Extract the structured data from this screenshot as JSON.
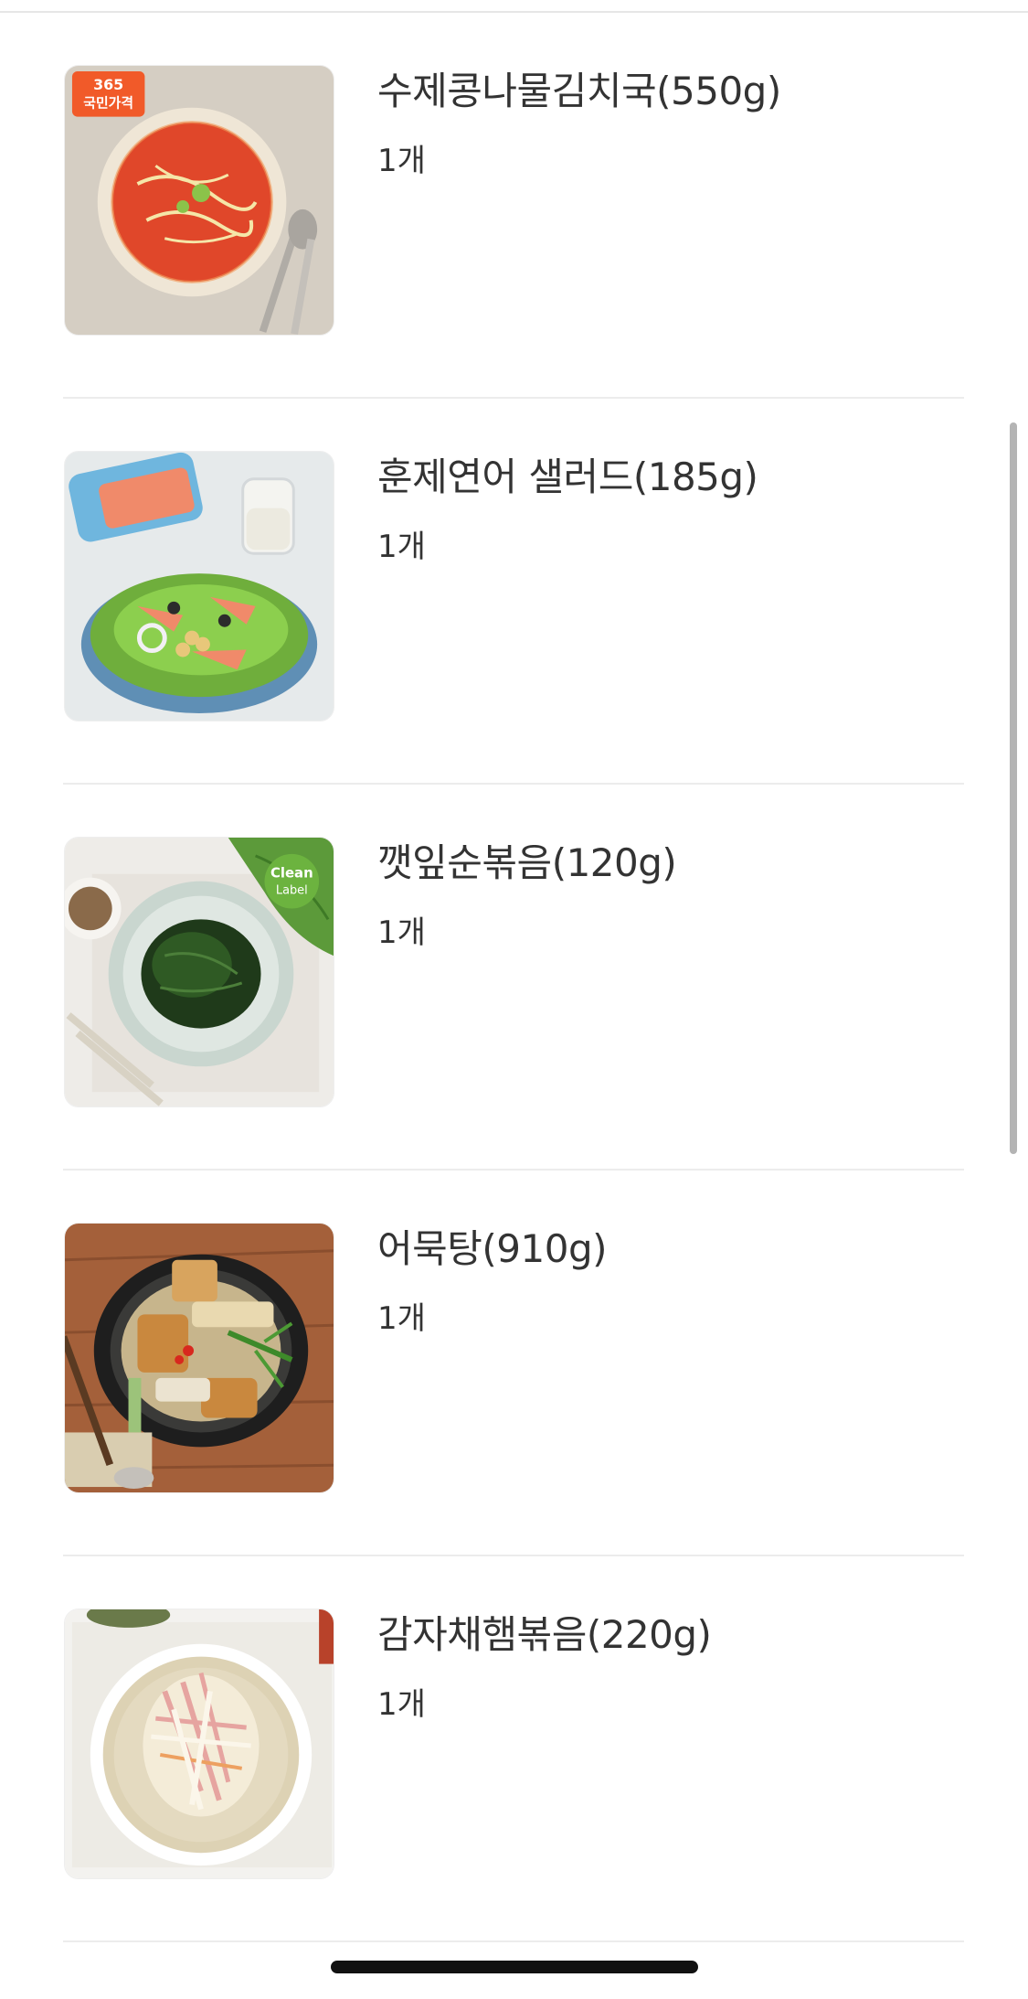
{
  "items": [
    {
      "name": "수제콩나물김치국(550g)",
      "quantity": "1개",
      "badge_line1": "365",
      "badge_line2": "국민가격"
    },
    {
      "name": "훈제연어 샐러드(185g)",
      "quantity": "1개"
    },
    {
      "name": "깻잎순볶음(120g)",
      "quantity": "1개",
      "badge_line1": "Clean",
      "badge_line2": "Label"
    },
    {
      "name": "어묵탕(910g)",
      "quantity": "1개"
    },
    {
      "name": "감자채햄볶음(220g)",
      "quantity": "1개"
    }
  ],
  "colors": {
    "divider": "#ececec",
    "text": "#333333",
    "badge_orange": "#f15a29",
    "badge_green": "#6cb33f"
  }
}
